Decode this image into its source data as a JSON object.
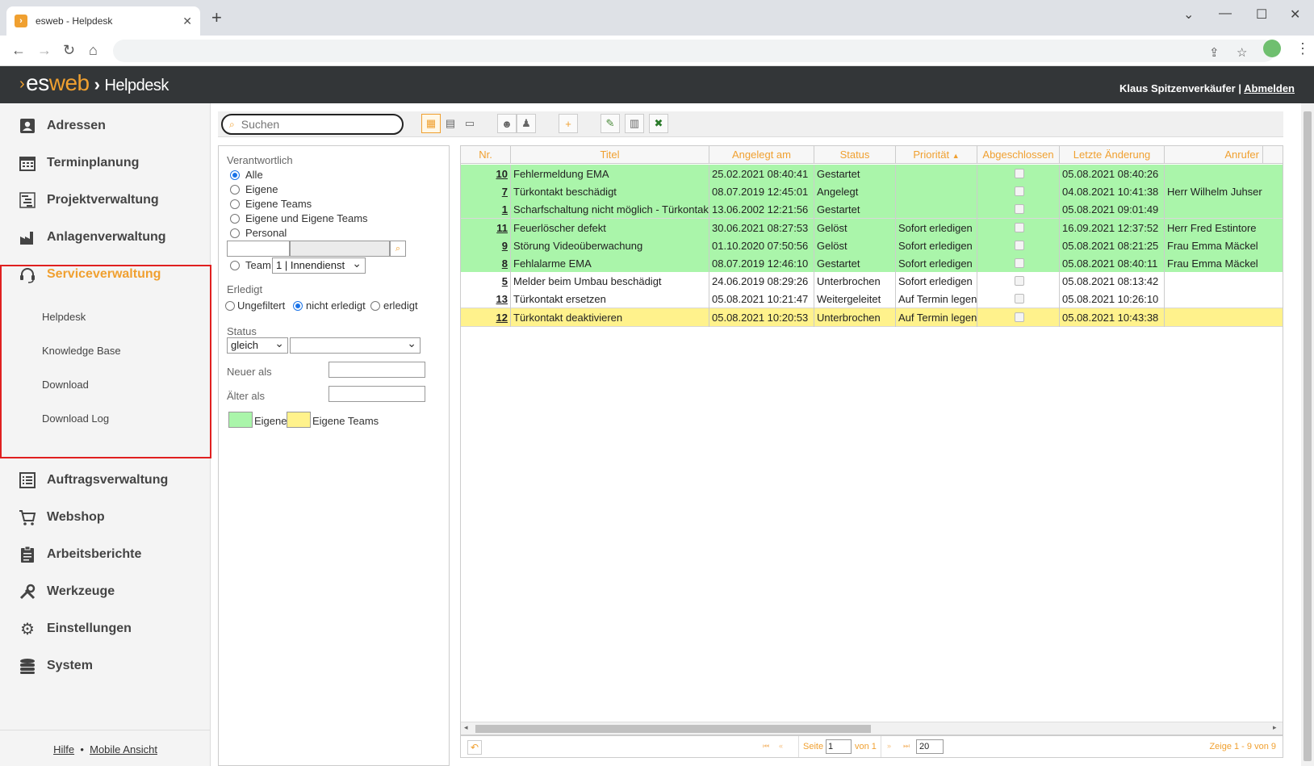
{
  "browser": {
    "tab_title": "esweb - Helpdesk",
    "favicon": "esweb-favicon"
  },
  "app": {
    "logo_es": "es",
    "logo_web": "web",
    "logo_sep": "›",
    "title": "Helpdesk",
    "user": "Klaus Spitzenverkäufer",
    "user_sep": "|",
    "logout": "Abmelden"
  },
  "sidebar": {
    "items": [
      {
        "label": "Adressen",
        "icon": "address-card-icon"
      },
      {
        "label": "Terminplanung",
        "icon": "calendar-icon"
      },
      {
        "label": "Projektverwaltung",
        "icon": "gantt-icon"
      },
      {
        "label": "Anlagenverwaltung",
        "icon": "factory-icon"
      },
      {
        "label": "Serviceverwaltung",
        "icon": "headset-icon"
      },
      {
        "label": "Auftragsverwaltung",
        "icon": "list-icon"
      },
      {
        "label": "Webshop",
        "icon": "cart-icon"
      },
      {
        "label": "Arbeitsberichte",
        "icon": "clipboard-icon"
      },
      {
        "label": "Werkzeuge",
        "icon": "tools-icon"
      },
      {
        "label": "Einstellungen",
        "icon": "gears-icon"
      },
      {
        "label": "System",
        "icon": "database-icon"
      }
    ],
    "subitems": [
      "Helpdesk",
      "Knowledge Base",
      "Download",
      "Download Log"
    ],
    "footer": {
      "help": "Hilfe",
      "dot": "•",
      "mobile": "Mobile Ansicht"
    }
  },
  "toolbar": {
    "search_placeholder": "Suchen"
  },
  "filter": {
    "responsible_label": "Verantwortlich",
    "responsible_options": [
      "Alle",
      "Eigene",
      "Eigene Teams",
      "Eigene und Eigene Teams",
      "Personal"
    ],
    "team_label": "Team",
    "team_value": "1 | Innendienst",
    "done_label": "Erledigt",
    "done_options": [
      "Ungefiltert",
      "nicht erledigt",
      "erledigt"
    ],
    "status_label": "Status",
    "status_op": "gleich",
    "status_value": "",
    "newer_label": "Neuer als",
    "older_label": "Älter als",
    "legend_own": "Eigene",
    "legend_teams": "Eigene Teams",
    "color_own": "#aaf5aa",
    "color_teams": "#fff28c"
  },
  "grid": {
    "columns": [
      "Nr.",
      "Titel",
      "Angelegt am",
      "Status",
      "Priorität",
      "Abgeschlossen",
      "Letzte Änderung",
      "Anrufer"
    ],
    "sort_indicator": "▲",
    "rows": [
      {
        "nr": "10",
        "titel": "Fehlermeldung EMA",
        "angelegt": "25.02.2021 08:40:41",
        "status": "Gestartet",
        "prio": "",
        "letzte": "05.08.2021 08:40:26",
        "anrufer": "",
        "color": "#aaf5aa"
      },
      {
        "nr": "7",
        "titel": "Türkontakt beschädigt",
        "angelegt": "08.07.2019 12:45:01",
        "status": "Angelegt",
        "prio": "",
        "letzte": "04.08.2021 10:41:38",
        "anrufer": "Herr Wilhelm Juhser",
        "color": "#aaf5aa"
      },
      {
        "nr": "1",
        "titel": "Scharfschaltung nicht möglich - Türkontakt d",
        "angelegt": "13.06.2002 12:21:56",
        "status": "Gestartet",
        "prio": "",
        "letzte": "05.08.2021 09:01:49",
        "anrufer": "",
        "color": "#aaf5aa"
      },
      {
        "nr": "11",
        "titel": "Feuerlöscher defekt",
        "angelegt": "30.06.2021 08:27:53",
        "status": "Gelöst",
        "prio": "Sofort erledigen",
        "letzte": "16.09.2021 12:37:52",
        "anrufer": "Herr Fred Estintore",
        "color": "#aaf5aa"
      },
      {
        "nr": "9",
        "titel": "Störung Videoüberwachung",
        "angelegt": "01.10.2020 07:50:56",
        "status": "Gelöst",
        "prio": "Sofort erledigen",
        "letzte": "05.08.2021 08:21:25",
        "anrufer": "Frau Emma Mäckel",
        "color": "#aaf5aa"
      },
      {
        "nr": "8",
        "titel": "Fehlalarme EMA",
        "angelegt": "08.07.2019 12:46:10",
        "status": "Gestartet",
        "prio": "Sofort erledigen",
        "letzte": "05.08.2021 08:40:11",
        "anrufer": "Frau Emma Mäckel",
        "color": "#aaf5aa"
      },
      {
        "nr": "5",
        "titel": "Melder beim Umbau beschädigt",
        "angelegt": "24.06.2019 08:29:26",
        "status": "Unterbrochen",
        "prio": "Sofort erledigen",
        "letzte": "05.08.2021 08:13:42",
        "anrufer": "",
        "color": "#ffffff"
      },
      {
        "nr": "13",
        "titel": "Türkontakt ersetzen",
        "angelegt": "05.08.2021 10:21:47",
        "status": "Weitergeleitet",
        "prio": "Auf Termin legen",
        "letzte": "05.08.2021 10:26:10",
        "anrufer": "",
        "color": "#ffffff"
      },
      {
        "nr": "12",
        "titel": "Türkontakt deaktivieren",
        "angelegt": "05.08.2021 10:20:53",
        "status": "Unterbrochen",
        "prio": "Auf Termin legen",
        "letzte": "05.08.2021 10:43:38",
        "anrufer": "",
        "color": "#fff28c"
      }
    ]
  },
  "pager": {
    "page_label": "Seite",
    "page_value": "1",
    "of_label": "von 1",
    "page_size": "20",
    "summary": "Zeige 1 - 9 von 9"
  }
}
